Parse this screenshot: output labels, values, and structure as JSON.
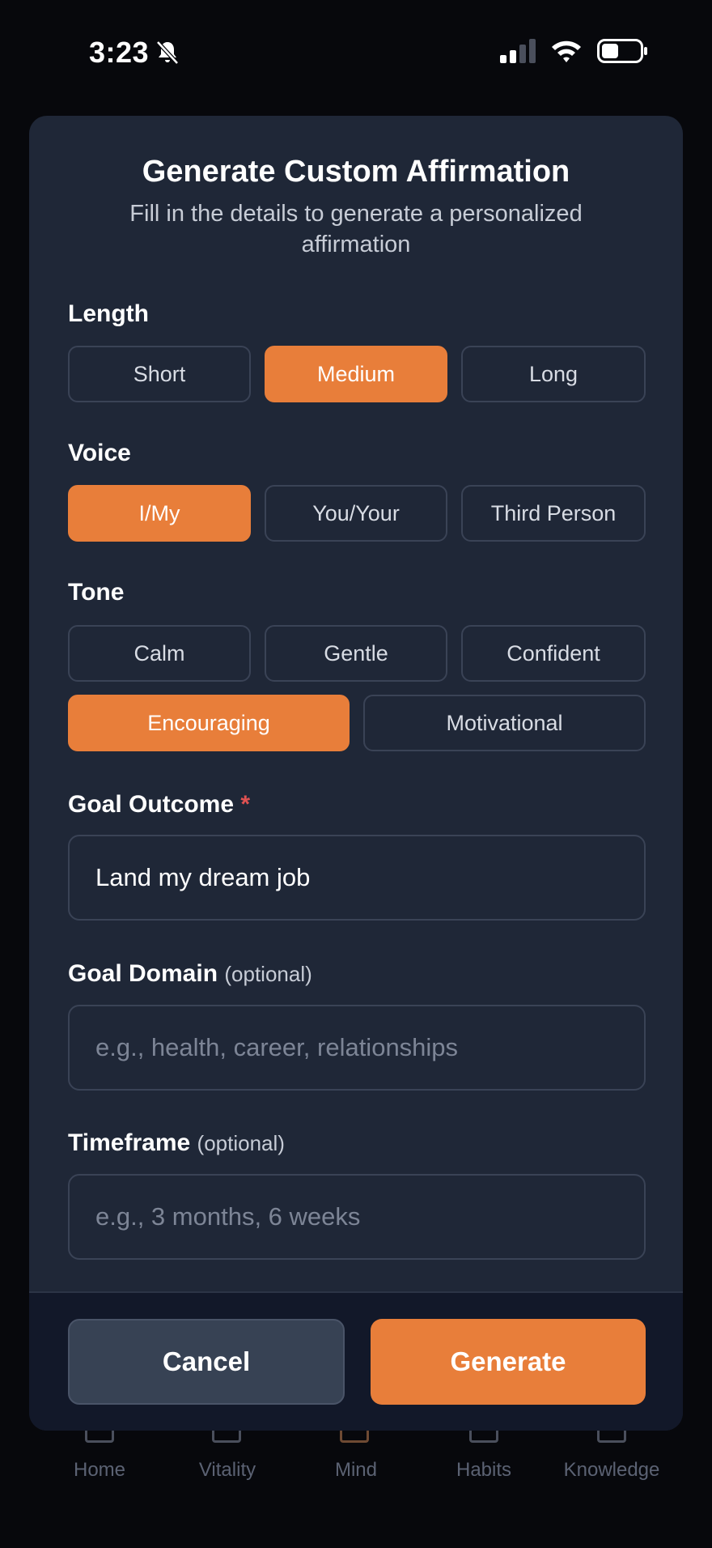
{
  "status_bar": {
    "time": "3:23"
  },
  "modal": {
    "title": "Generate Custom Affirmation",
    "subtitle": "Fill in the details to generate a personalized affirmation",
    "length": {
      "label": "Length",
      "options": [
        "Short",
        "Medium",
        "Long"
      ],
      "selected": "Medium"
    },
    "voice": {
      "label": "Voice",
      "options": [
        "I/My",
        "You/Your",
        "Third Person"
      ],
      "selected": "I/My"
    },
    "tone": {
      "label": "Tone",
      "options": [
        "Calm",
        "Gentle",
        "Confident",
        "Encouraging",
        "Motivational"
      ],
      "selected": "Encouraging"
    },
    "goal_outcome": {
      "label": "Goal Outcome",
      "required_mark": "*",
      "value": "Land my dream job"
    },
    "goal_domain": {
      "label": "Goal Domain",
      "optional_tag": "(optional)",
      "placeholder": "e.g., health, career, relationships"
    },
    "timeframe": {
      "label": "Timeframe",
      "optional_tag": "(optional)",
      "placeholder": "e.g., 3 months, 6 weeks"
    },
    "cancel_label": "Cancel",
    "generate_label": "Generate"
  },
  "tabbar": {
    "items": [
      "Home",
      "Vitality",
      "Mind",
      "Habits",
      "Knowledge"
    ]
  },
  "colors": {
    "accent": "#e87e3a",
    "modal_bg": "#1f2737",
    "required": "#e05252"
  }
}
